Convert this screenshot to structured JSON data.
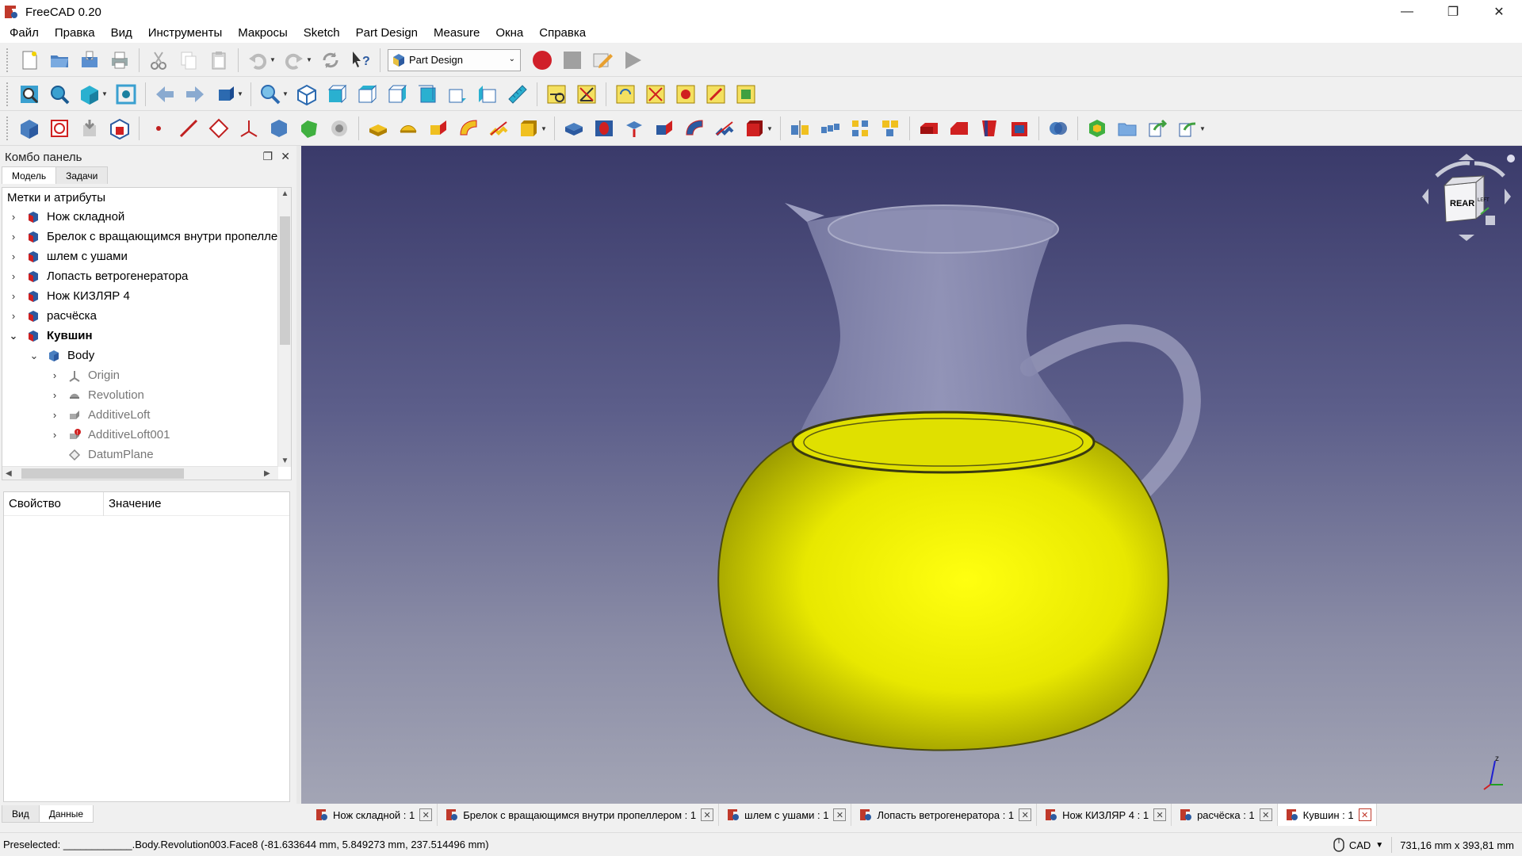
{
  "window": {
    "title": "FreeCAD 0.20",
    "minimize_glyph": "—",
    "maximize_glyph": "❐",
    "close_glyph": "✕"
  },
  "menu": [
    "Файл",
    "Правка",
    "Вид",
    "Инструменты",
    "Макросы",
    "Sketch",
    "Part Design",
    "Measure",
    "Окна",
    "Справка"
  ],
  "workbench_selector": {
    "value": "Part Design"
  },
  "combo_panel": {
    "title": "Комбо панель",
    "tabs": [
      "Модель",
      "Задачи"
    ],
    "tree_header": "Метки и атрибуты",
    "tree": [
      {
        "label": "Нож складной",
        "expand": "›",
        "icon": "part-doc-icon"
      },
      {
        "label": "Брелок с вращающимся внутри пропелле",
        "expand": "›",
        "icon": "part-doc-icon"
      },
      {
        "label": "шлем с ушами",
        "expand": "›",
        "icon": "part-doc-icon"
      },
      {
        "label": "Лопасть ветрогенератора",
        "expand": "›",
        "icon": "part-doc-icon"
      },
      {
        "label": "Нож КИЗЛЯР 4",
        "expand": "›",
        "icon": "part-doc-icon"
      },
      {
        "label": "расчёска",
        "expand": "›",
        "icon": "part-doc-icon"
      },
      {
        "label": "Кувшин",
        "expand": "⌄",
        "icon": "part-doc-icon"
      },
      {
        "label": "Body",
        "expand": "⌄",
        "icon": "body-icon"
      },
      {
        "label": "Origin",
        "expand": "›",
        "icon": "origin-icon"
      },
      {
        "label": "Revolution",
        "expand": "›",
        "icon": "revolution-icon"
      },
      {
        "label": "AdditiveLoft",
        "expand": "›",
        "icon": "loft-icon"
      },
      {
        "label": "AdditiveLoft001",
        "expand": "›",
        "icon": "loft-error-icon"
      },
      {
        "label": "DatumPlane",
        "expand": "",
        "icon": "datum-plane-icon"
      }
    ],
    "property_columns": [
      "Свойство",
      "Значение"
    ],
    "bottom_tabs": [
      "Вид",
      "Данные"
    ]
  },
  "nav_cube": {
    "face_label": "REAR",
    "side_label": "LEFT"
  },
  "axis_labels": {
    "z": "z"
  },
  "doc_tabs": [
    {
      "label": "Нож складной : 1",
      "active": false
    },
    {
      "label": "Брелок с вращающимся внутри пропеллером : 1",
      "active": false
    },
    {
      "label": "шлем с ушами : 1",
      "active": false
    },
    {
      "label": "Лопасть ветрогенератора : 1",
      "active": false
    },
    {
      "label": "Нож КИЗЛЯР 4 : 1",
      "active": false
    },
    {
      "label": "расчёска : 1",
      "active": false
    },
    {
      "label": "Кувшин : 1",
      "active": true
    }
  ],
  "status": {
    "preselected": "Preselected: ____________.Body.Revolution003.Face8 (-81.633644 mm, 5.849273 mm, 237.514496 mm)",
    "nav_style": "CAD",
    "dimensions": "731,16 mm x 393,81 mm"
  },
  "colors": {
    "liquid": "#e6e600",
    "glass": "#8a8cae",
    "record": "#d0202a"
  }
}
